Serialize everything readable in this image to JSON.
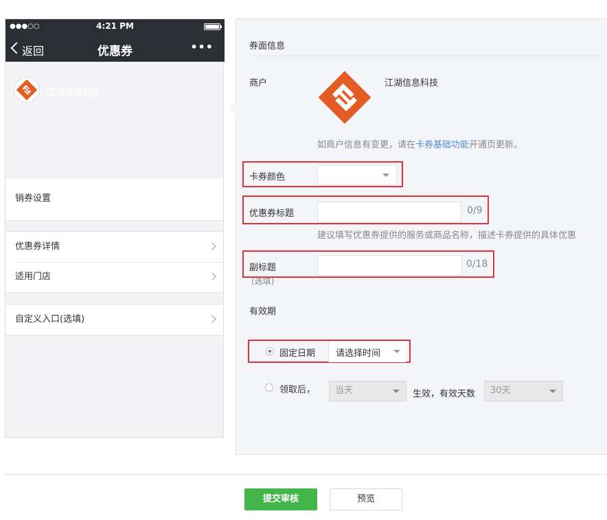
{
  "phone": {
    "status_signal": "●●●○○",
    "status_time": "4:21 PM",
    "back_label": "返回",
    "nav_title": "优惠券",
    "more_label": "•••",
    "merchant_name": "江湖信息科技",
    "cells_group1": [
      "销券设置"
    ],
    "cells_group2": [
      "优惠券详情",
      "适用门店"
    ],
    "cells_group3": [
      "自定义入口(选填)"
    ]
  },
  "form": {
    "section_title": "券面信息",
    "merchant_label": "商户",
    "merchant_name": "江湖信息科技",
    "merchant_hint_prefix": "如商户信息有变更，请在",
    "merchant_hint_link": "卡券基础功能",
    "merchant_hint_suffix": "开通页更新。",
    "color_label": "卡券颜色",
    "color_value": "",
    "title_label": "优惠券标题",
    "title_value": "",
    "title_counter": "0/9",
    "title_hint": "建议填写优惠券提供的服务或商品名称，描述卡券提供的具体优惠",
    "subtitle_label": "副标题",
    "subtitle_optional": "(选填)",
    "subtitle_value": "",
    "subtitle_counter": "0/18",
    "validity_label": "有效期",
    "fixed_date_label": "固定日期",
    "fixed_date_select": "请选择时间",
    "after_receive_label": "领取后，",
    "after_receive_select": "当天",
    "effective_text": "生效，有效天数",
    "days_select": "30天"
  },
  "footer": {
    "submit_label": "提交审核",
    "preview_label": "预览"
  },
  "colors": {
    "accent_green": "#44b549",
    "highlight_red": "#e0323c",
    "link_blue": "#4d8fcc",
    "logo_orange": "#e35c23"
  }
}
